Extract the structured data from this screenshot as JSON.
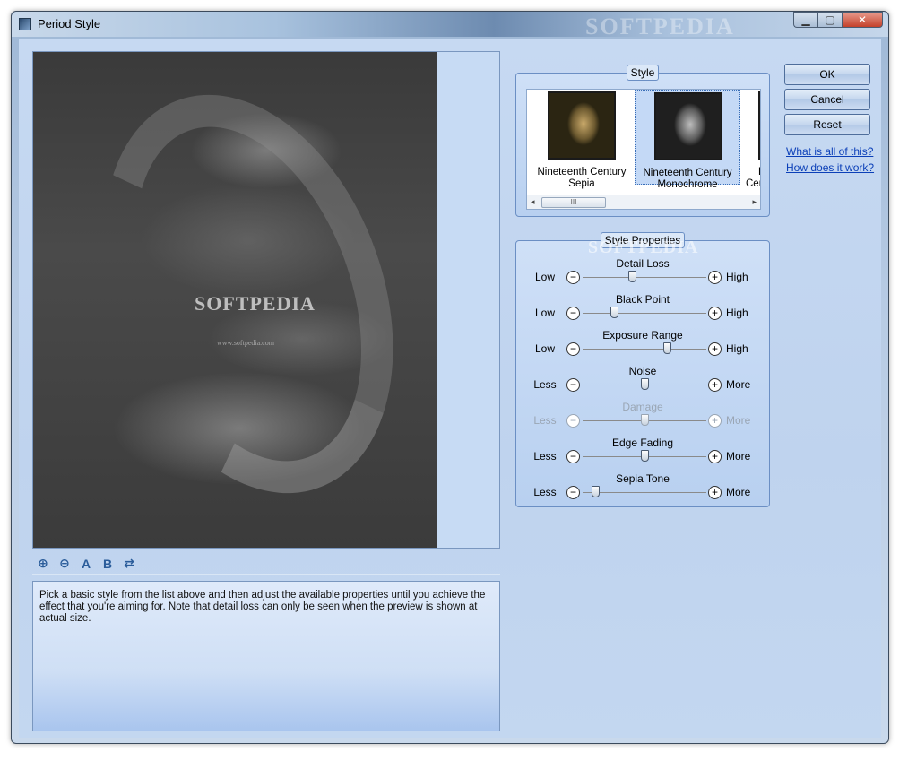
{
  "window": {
    "title": "Period Style",
    "title_watermark": "SOFTPEDIA",
    "minimize_glyph": "▁",
    "maximize_glyph": "▢",
    "close_glyph": "✕"
  },
  "preview": {
    "watermark": "SOFTPEDIA",
    "watermark_url": "www.softpedia.com"
  },
  "zoom_toolbar": {
    "zoom_in": "⊕",
    "zoom_out": "⊖",
    "view_a": "A",
    "view_b": "B",
    "swap": "⇄"
  },
  "description": "Pick a basic style from the list above and then adjust the available properties until you achieve the effect that you're aiming for. Note that detail loss can only be seen when the preview is shown at actual size.",
  "style_group": {
    "title": "Style",
    "items": [
      {
        "label_1": "Nineteenth Century",
        "label_2": "Sepia",
        "selected": false
      },
      {
        "label_1": "Nineteenth Century",
        "label_2": "Monochrome",
        "selected": true
      },
      {
        "label_1": "E",
        "label_2": "Cen",
        "selected": false
      }
    ],
    "scroll_left": "◂",
    "scroll_right": "▸",
    "scroll_grip": "III"
  },
  "props_group": {
    "title": "Style Properties",
    "watermark": "SOFTPEDIA",
    "properties": [
      {
        "name": "Detail Loss",
        "low": "Low",
        "high": "High",
        "level": 0.4,
        "enabled": true
      },
      {
        "name": "Black Point",
        "low": "Low",
        "high": "High",
        "level": 0.25,
        "enabled": true
      },
      {
        "name": "Exposure Range",
        "low": "Low",
        "high": "High",
        "level": 0.68,
        "enabled": true
      },
      {
        "name": "Noise",
        "low": "Less",
        "high": "More",
        "level": 0.5,
        "enabled": true
      },
      {
        "name": "Damage",
        "low": "Less",
        "high": "More",
        "level": 0.5,
        "enabled": false
      },
      {
        "name": "Edge Fading",
        "low": "Less",
        "high": "More",
        "level": 0.5,
        "enabled": true
      },
      {
        "name": "Sepia Tone",
        "low": "Less",
        "high": "More",
        "level": 0.1,
        "enabled": true
      }
    ]
  },
  "buttons": {
    "ok": "OK",
    "cancel": "Cancel",
    "reset": "Reset"
  },
  "links": {
    "what": "What is all of this?",
    "how": "How does it work?"
  }
}
